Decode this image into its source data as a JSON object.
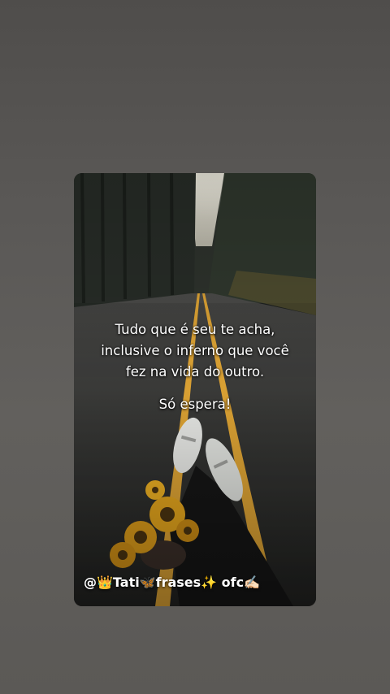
{
  "story": {
    "quote_lines": [
      "Tudo que é seu te acha,",
      "inclusive o inferno que você",
      "fez na vida do outro."
    ],
    "closing_line": "Só espera!",
    "credit": "@👑Tati🦋frases✨ ofc✍🏻"
  },
  "image": {
    "scene": "forest-road-with-sneakers-and-sunflowers",
    "road_line_color": "#d9a033",
    "flower_color": "#e0a21c"
  }
}
